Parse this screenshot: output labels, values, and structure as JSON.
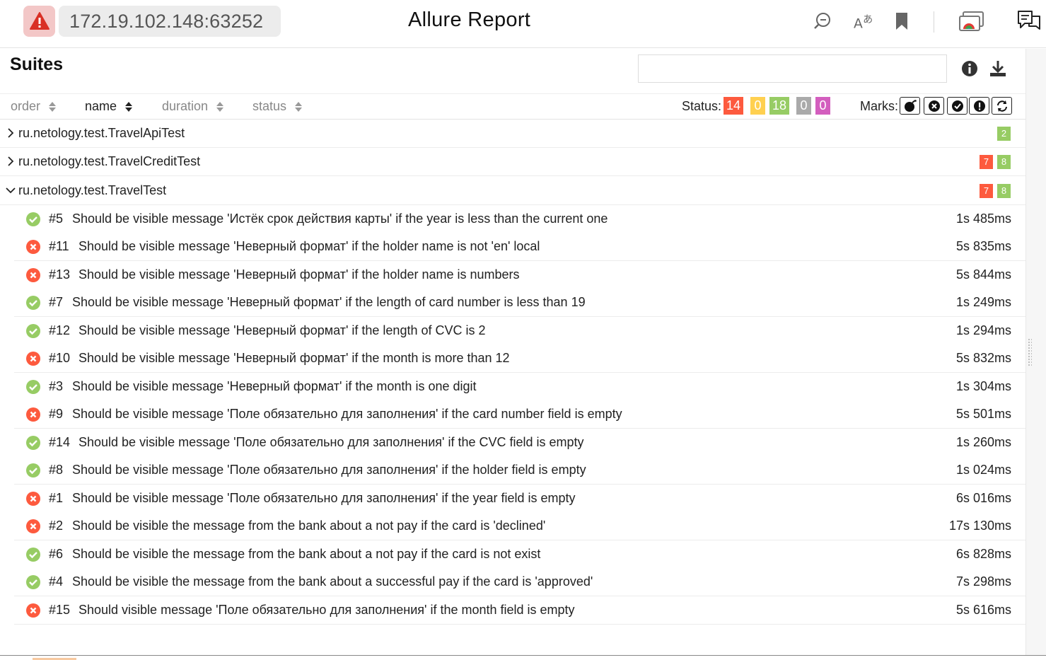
{
  "browser": {
    "url": "172.19.102.148:63252",
    "title": "Allure Report",
    "icons": [
      "warning-icon",
      "zoom-icon",
      "translate-icon",
      "bookmark-icon",
      "cast-icon",
      "reader-icon"
    ]
  },
  "colors": {
    "failed": "#fd5a3e",
    "broken": "#ffd050",
    "passed": "#97cc64",
    "skipped": "#aaaaaa",
    "unknown": "#d35ebe"
  },
  "header": {
    "title": "Suites",
    "search_value": ""
  },
  "sort": {
    "order_label": "order",
    "name_label": "name",
    "duration_label": "duration",
    "status_label": "status"
  },
  "filter": {
    "status_label": "Status:",
    "failed": "14",
    "broken": "0",
    "passed": "18",
    "skipped": "0",
    "unknown": "0",
    "marks_label": "Marks:"
  },
  "groups": [
    {
      "name": "ru.netology.test.TravelApiTest",
      "expanded": false,
      "counts": [
        {
          "status": "passed",
          "value": "2"
        }
      ]
    },
    {
      "name": "ru.netology.test.TravelCreditTest",
      "expanded": false,
      "counts": [
        {
          "status": "failed",
          "value": "7"
        },
        {
          "status": "passed",
          "value": "8"
        }
      ]
    },
    {
      "name": "ru.netology.test.TravelTest",
      "expanded": true,
      "counts": [
        {
          "status": "failed",
          "value": "7"
        },
        {
          "status": "passed",
          "value": "8"
        }
      ]
    }
  ],
  "cases": [
    {
      "status": "passed",
      "num": "#5",
      "name": "Should be visible message 'Истёк срок действия карты' if the year is less than the current one",
      "duration": "1s 485ms"
    },
    {
      "status": "failed",
      "num": "#11",
      "name": "Should be visible message 'Неверный формат' if the holder name is not 'en' local",
      "duration": "5s 835ms"
    },
    {
      "status": "failed",
      "num": "#13",
      "name": "Should be visible message 'Неверный формат' if the holder name is numbers",
      "duration": "5s 844ms"
    },
    {
      "status": "passed",
      "num": "#7",
      "name": "Should be visible message 'Неверный формат' if the length of card number is less than 19",
      "duration": "1s 249ms"
    },
    {
      "status": "passed",
      "num": "#12",
      "name": "Should be visible message 'Неверный формат' if the length of CVC is 2",
      "duration": "1s 294ms"
    },
    {
      "status": "failed",
      "num": "#10",
      "name": "Should be visible message 'Неверный формат' if the month is more than 12",
      "duration": "5s 832ms"
    },
    {
      "status": "passed",
      "num": "#3",
      "name": "Should be visible message 'Неверный формат' if the month is one digit",
      "duration": "1s 304ms"
    },
    {
      "status": "failed",
      "num": "#9",
      "name": "Should be visible message 'Поле обязательно для заполнения' if the card number field is empty",
      "duration": "5s 501ms"
    },
    {
      "status": "passed",
      "num": "#14",
      "name": "Should be visible message 'Поле обязательно для заполнения' if the CVC field is empty",
      "duration": "1s 260ms"
    },
    {
      "status": "passed",
      "num": "#8",
      "name": "Should be visible message 'Поле обязательно для заполнения' if the holder field is empty",
      "duration": "1s 024ms"
    },
    {
      "status": "failed",
      "num": "#1",
      "name": "Should be visible message 'Поле обязательно для заполнения' if the year field is empty",
      "duration": "6s 016ms"
    },
    {
      "status": "failed",
      "num": "#2",
      "name": "Should be visible the message from the bank about a not pay if the card is 'declined'",
      "duration": "17s 130ms"
    },
    {
      "status": "passed",
      "num": "#6",
      "name": "Should be visible the message from the bank about a not pay if the card is not exist",
      "duration": "6s 828ms"
    },
    {
      "status": "passed",
      "num": "#4",
      "name": "Should be visible the message from the bank about a successful pay if the card is 'approved'",
      "duration": "7s 298ms"
    },
    {
      "status": "failed",
      "num": "#15",
      "name": "Should visible message 'Поле обязательно для заполнения' if the month field is empty",
      "duration": "5s 616ms"
    }
  ]
}
